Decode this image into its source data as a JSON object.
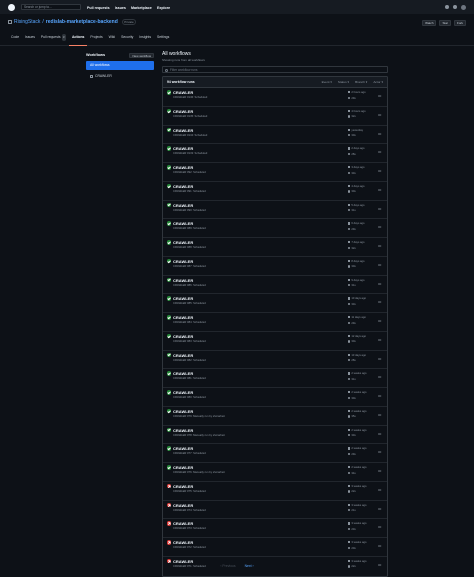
{
  "topbar": {
    "search_placeholder": "Search or jump to...",
    "nav": [
      "Pull requests",
      "Issues",
      "Marketplace",
      "Explore"
    ]
  },
  "repo": {
    "owner": "RisingStack",
    "separator": "/",
    "name": "redislab-marketplace-backend",
    "visibility": "Private",
    "buttons": [
      "Watch",
      "Star",
      "Fork"
    ]
  },
  "tabs": [
    {
      "label": "Code",
      "count": ""
    },
    {
      "label": "Issues",
      "count": ""
    },
    {
      "label": "Pull requests",
      "count": "3"
    },
    {
      "label": "Actions",
      "count": ""
    },
    {
      "label": "Projects",
      "count": ""
    },
    {
      "label": "Wiki",
      "count": ""
    },
    {
      "label": "Security",
      "count": ""
    },
    {
      "label": "Insights",
      "count": ""
    },
    {
      "label": "Settings",
      "count": ""
    }
  ],
  "sidebar": {
    "title": "Workflows",
    "new_button": "New workflow",
    "items": [
      "All workflows",
      "CRAWLER"
    ]
  },
  "main": {
    "title": "All workflows",
    "subtitle": "Showing runs from all workflows",
    "filter_placeholder": "Filter workflow runs",
    "count_label": "94 workflow runs",
    "filters": [
      "Event",
      "Status",
      "Branch",
      "Actor"
    ]
  },
  "runs": [
    {
      "status": "success",
      "name": "CRAWLER",
      "sub": "CRAWLER #136: Scheduled",
      "time": "2 hours ago",
      "dur": "29s"
    },
    {
      "status": "success",
      "name": "CRAWLER",
      "sub": "CRAWLER #135: Scheduled",
      "time": "4 hours ago",
      "dur": "32s"
    },
    {
      "status": "success",
      "name": "CRAWLER",
      "sub": "CRAWLER #134: Scheduled",
      "time": "yesterday",
      "dur": "30s"
    },
    {
      "status": "success",
      "name": "CRAWLER",
      "sub": "CRAWLER #133: Scheduled",
      "time": "2 days ago",
      "dur": "28s"
    },
    {
      "status": "success",
      "name": "CRAWLER",
      "sub": "CRAWLER #92: Scheduled",
      "time": "3 days ago",
      "dur": "33s"
    },
    {
      "status": "success",
      "name": "CRAWLER",
      "sub": "CRAWLER #91: Scheduled",
      "time": "4 days ago",
      "dur": "30s"
    },
    {
      "status": "success",
      "name": "CRAWLER",
      "sub": "CRAWLER #90: Scheduled",
      "time": "5 days ago",
      "dur": "31s"
    },
    {
      "status": "success",
      "name": "CRAWLER",
      "sub": "CRAWLER #89: Scheduled",
      "time": "6 days ago",
      "dur": "29s"
    },
    {
      "status": "success",
      "name": "CRAWLER",
      "sub": "CRAWLER #88: Scheduled",
      "time": "7 days ago",
      "dur": "32s"
    },
    {
      "status": "success",
      "name": "CRAWLER",
      "sub": "CRAWLER #87: Scheduled",
      "time": "8 days ago",
      "dur": "30s"
    },
    {
      "status": "success",
      "name": "CRAWLER",
      "sub": "CRAWLER #86: Scheduled",
      "time": "9 days ago",
      "dur": "31s"
    },
    {
      "status": "success",
      "name": "CRAWLER",
      "sub": "CRAWLER #85: Scheduled",
      "time": "10 days ago",
      "dur": "33s"
    },
    {
      "status": "success",
      "name": "CRAWLER",
      "sub": "CRAWLER #84: Scheduled",
      "time": "11 days ago",
      "dur": "29s"
    },
    {
      "status": "success",
      "name": "CRAWLER",
      "sub": "CRAWLER #83: Scheduled",
      "time": "12 days ago",
      "dur": "30s"
    },
    {
      "status": "success",
      "name": "CRAWLER",
      "sub": "CRAWLER #82: Scheduled",
      "time": "13 days ago",
      "dur": "28s"
    },
    {
      "status": "success",
      "name": "CRAWLER",
      "sub": "CRAWLER #81: Scheduled",
      "time": "2 weeks ago",
      "dur": "31s"
    },
    {
      "status": "success",
      "name": "CRAWLER",
      "sub": "CRAWLER #80: Scheduled",
      "time": "2 weeks ago",
      "dur": "30s"
    },
    {
      "status": "success",
      "name": "CRAWLER",
      "sub": "CRAWLER #79: Manually run by shorarbeit",
      "time": "2 weeks ago",
      "dur": "35s"
    },
    {
      "status": "success",
      "name": "CRAWLER",
      "sub": "CRAWLER #78: Manually run by shorarbeit",
      "time": "2 weeks ago",
      "dur": "33s"
    },
    {
      "status": "success",
      "name": "CRAWLER",
      "sub": "CRAWLER #77: Scheduled",
      "time": "2 weeks ago",
      "dur": "29s"
    },
    {
      "status": "success",
      "name": "CRAWLER",
      "sub": "CRAWLER #76: Manually run by shorarbeit",
      "time": "2 weeks ago",
      "dur": "34s"
    },
    {
      "status": "failure",
      "name": "CRAWLER",
      "sub": "CRAWLER #75: Scheduled",
      "time": "3 weeks ago",
      "dur": "22s"
    },
    {
      "status": "failure",
      "name": "CRAWLER",
      "sub": "CRAWLER #74: Scheduled",
      "time": "3 weeks ago",
      "dur": "21s"
    },
    {
      "status": "failure",
      "name": "CRAWLER",
      "sub": "CRAWLER #73: Scheduled",
      "time": "3 weeks ago",
      "dur": "23s"
    },
    {
      "status": "failure",
      "name": "CRAWLER",
      "sub": "CRAWLER #72: Scheduled",
      "time": "3 weeks ago",
      "dur": "20s"
    },
    {
      "status": "failure",
      "name": "CRAWLER",
      "sub": "CRAWLER #71: Scheduled",
      "time": "3 weeks ago",
      "dur": "22s"
    }
  ],
  "pager": {
    "prev": "Previous",
    "next": "Next"
  },
  "colors": {
    "accent": "#1f6feb",
    "success": "#238636",
    "failure": "#da3633",
    "link": "#58a6ff"
  }
}
